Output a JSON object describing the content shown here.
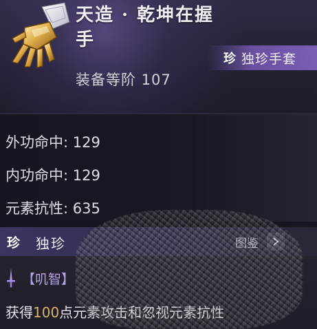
{
  "item": {
    "name": "天造 · 乾坤在握手",
    "icon": "golden-gauntlet-icon",
    "rarity_badge": "珍",
    "rarity_type": "独珍手套",
    "equip_level": "装备等阶 107"
  },
  "stats": [
    {
      "label": "外功命中",
      "sep": ": ",
      "value": "129"
    },
    {
      "label": "内功命中",
      "sep": ": ",
      "value": "129"
    },
    {
      "label": "元素抗性",
      "sep": ": ",
      "value": "635"
    }
  ],
  "set": {
    "badge": "珍",
    "name": "独珍",
    "catalog_label": "图鉴",
    "catalog_icon": "chevron-right-icon"
  },
  "effect": {
    "skill_icon": "dagger-icon",
    "skill_label": "【叽智】",
    "text_prefix": "获得",
    "text_number": "100",
    "text_suffix": "点元素攻击和忽视元素抗性"
  },
  "colors": {
    "accent_purple": "#8c69d7",
    "number_gold": "#d9b56a",
    "skill_purple": "#b9a4e8"
  }
}
